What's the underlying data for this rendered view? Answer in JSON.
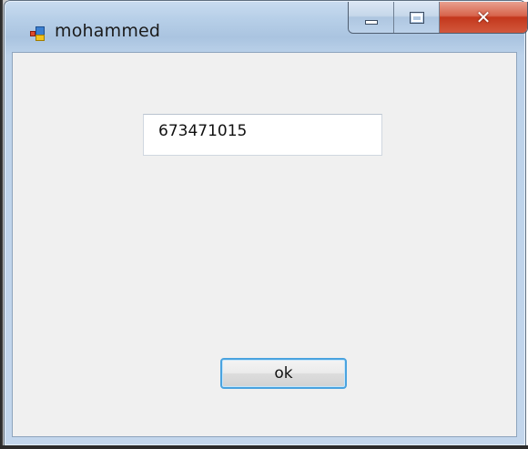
{
  "window": {
    "title": "mohammed",
    "app_icon": "app-window-icon",
    "controls": {
      "minimize_icon": "minimize-icon",
      "maximize_icon": "maximize-icon",
      "close_icon": "close-icon",
      "close_glyph": "✕"
    }
  },
  "form": {
    "textbox_value": "673471015",
    "ok_label": "ok"
  },
  "colors": {
    "close_button": "#c3371c",
    "focus_border": "#4aa3df",
    "client_background": "#f0f0f0"
  }
}
